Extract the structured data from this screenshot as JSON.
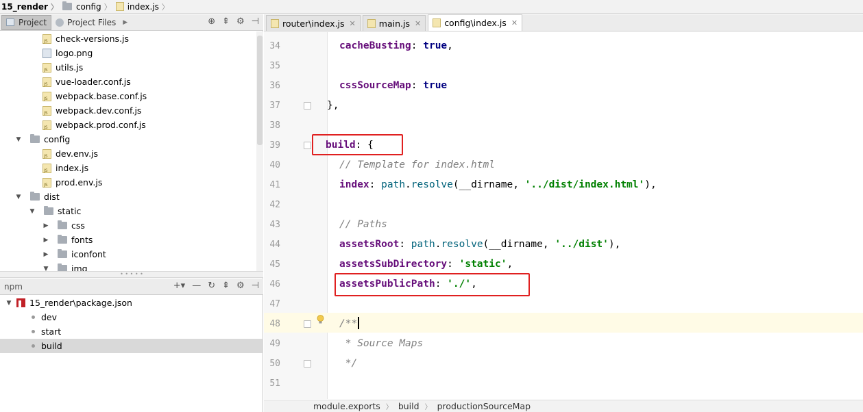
{
  "breadcrumb": [
    "15_render",
    "config",
    "index.js"
  ],
  "project_panel": {
    "tabs": [
      "Project",
      "Project Files"
    ],
    "tree": [
      {
        "label": "check-versions.js",
        "type": "js"
      },
      {
        "label": "logo.png",
        "type": "png"
      },
      {
        "label": "utils.js",
        "type": "js"
      },
      {
        "label": "vue-loader.conf.js",
        "type": "js"
      },
      {
        "label": "webpack.base.conf.js",
        "type": "js"
      },
      {
        "label": "webpack.dev.conf.js",
        "type": "js"
      },
      {
        "label": "webpack.prod.conf.js",
        "type": "js"
      },
      {
        "label": "config",
        "type": "folder"
      },
      {
        "label": "dev.env.js",
        "type": "js"
      },
      {
        "label": "index.js",
        "type": "js"
      },
      {
        "label": "prod.env.js",
        "type": "js"
      },
      {
        "label": "dist",
        "type": "folder"
      },
      {
        "label": "static",
        "type": "folder"
      },
      {
        "label": "css",
        "type": "folder"
      },
      {
        "label": "fonts",
        "type": "folder"
      },
      {
        "label": "iconfont",
        "type": "folder"
      },
      {
        "label": "img",
        "type": "folder"
      }
    ]
  },
  "npm_panel": {
    "title": "npm",
    "package": "15_render\\package.json",
    "scripts": [
      "dev",
      "start",
      "build"
    ],
    "selected": "build"
  },
  "editor": {
    "tabs": [
      "router\\index.js",
      "main.js",
      "config\\index.js"
    ],
    "active_tab": "config\\index.js",
    "line_numbers": [
      "34",
      "35",
      "36",
      "37",
      "38",
      "39",
      "40",
      "41",
      "42",
      "43",
      "44",
      "45",
      "46",
      "47",
      "48",
      "49",
      "50",
      "51"
    ],
    "code": {
      "l34_key": "cacheBusting",
      "l34_colon": ": ",
      "l34_val": "true",
      "l34_end": ",",
      "l36_key": "cssSourceMap",
      "l36_colon": ": ",
      "l36_val": "true",
      "l37": "},",
      "l39_key": "build",
      "l39_rest": ": {",
      "l40": "// Template for index.html",
      "l41_key": "index",
      "l41_a": ": ",
      "l41_obj": "path",
      "l41_dot": ".",
      "l41_fn": "resolve",
      "l41_b": "(__dirname, ",
      "l41_str": "'../dist/index.html'",
      "l41_c": "),",
      "l43": "// Paths",
      "l44_key": "assetsRoot",
      "l44_a": ": ",
      "l44_obj": "path",
      "l44_dot": ".",
      "l44_fn": "resolve",
      "l44_b": "(__dirname, ",
      "l44_str": "'../dist'",
      "l44_c": "),",
      "l45_key": "assetsSubDirectory",
      "l45_a": ": ",
      "l45_str": "'static'",
      "l45_c": ",",
      "l46_key": "assetsPublicPath",
      "l46_a": ": ",
      "l46_str": "'./'",
      "l46_c": ",",
      "l48": "/**",
      "l49": " * Source Maps",
      "l50": " */"
    }
  },
  "status_bar": [
    "module.exports",
    "build",
    "productionSourceMap"
  ],
  "colors": {
    "highlight_box": "#e02020",
    "current_line": "#fffbe6"
  }
}
